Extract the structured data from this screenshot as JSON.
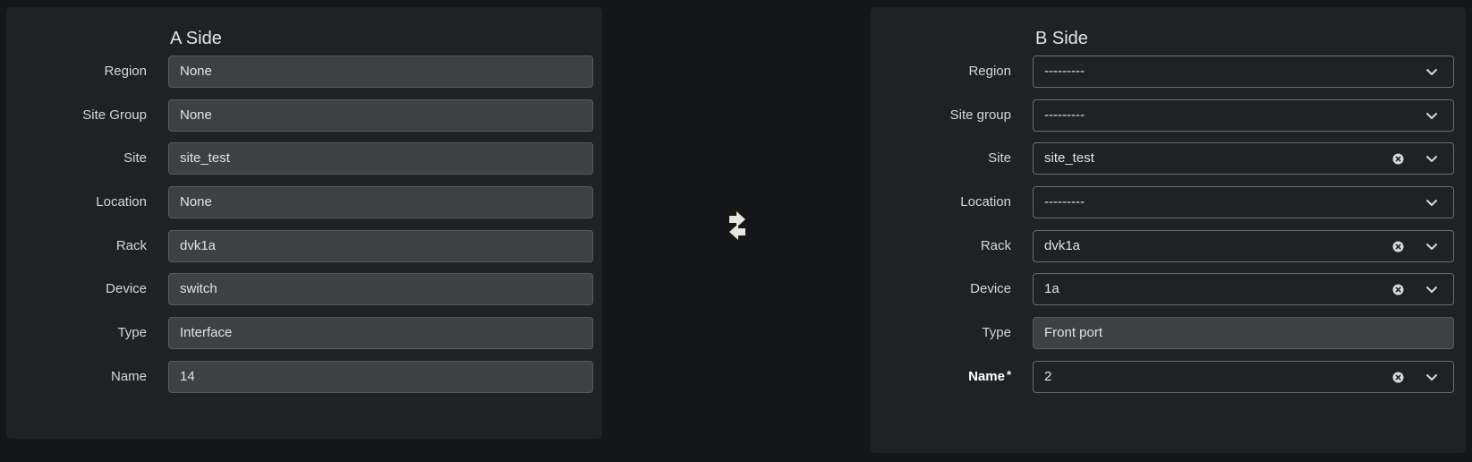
{
  "a_side": {
    "title": "A Side",
    "fields": [
      {
        "label": "Region",
        "value": "None"
      },
      {
        "label": "Site Group",
        "value": "None"
      },
      {
        "label": "Site",
        "value": "site_test"
      },
      {
        "label": "Location",
        "value": "None"
      },
      {
        "label": "Rack",
        "value": "dvk1a"
      },
      {
        "label": "Device",
        "value": "switch"
      },
      {
        "label": "Type",
        "value": "Interface"
      },
      {
        "label": "Name",
        "value": "14"
      }
    ]
  },
  "b_side": {
    "title": "B Side",
    "fields": [
      {
        "label": "Region",
        "value": "---------"
      },
      {
        "label": "Site group",
        "value": "---------"
      },
      {
        "label": "Site",
        "value": "site_test"
      },
      {
        "label": "Location",
        "value": "---------"
      },
      {
        "label": "Rack",
        "value": "dvk1a"
      },
      {
        "label": "Device",
        "value": "1a"
      },
      {
        "label": "Type",
        "value": "Front port"
      },
      {
        "label": "Name",
        "value": "2",
        "required_mark": "*"
      }
    ]
  },
  "icons": {
    "swap": "swap-arrows-icon",
    "dropdown": "chevron-down-icon",
    "clear": "clear-x-icon"
  }
}
